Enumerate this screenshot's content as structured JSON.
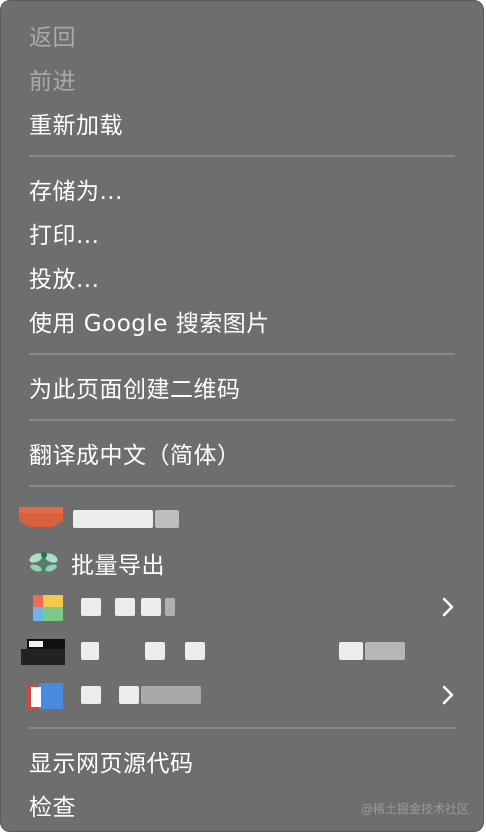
{
  "menu": {
    "group1": {
      "back": "返回",
      "forward": "前进",
      "reload": "重新加载"
    },
    "group2": {
      "save_as": "存储为...",
      "print": "打印...",
      "cast": "投放...",
      "google_image": "使用 Google 搜索图片"
    },
    "group3": {
      "qr": "为此页面创建二维码"
    },
    "group4": {
      "translate": "翻译成中文（简体）"
    },
    "extensions": {
      "batch_export": "批量导出"
    },
    "group6": {
      "view_source": "显示网页源代码",
      "inspect": "检查"
    }
  },
  "icons": {
    "ext1": "red-extension-icon",
    "ext2": "dragonfly-icon",
    "ext3": "colorful-extension-icon",
    "ext4": "black-extension-icon",
    "ext5": "red-blue-extension-icon",
    "submenu": "chevron-right-icon"
  },
  "watermark": "@稀土掘金技术社区"
}
